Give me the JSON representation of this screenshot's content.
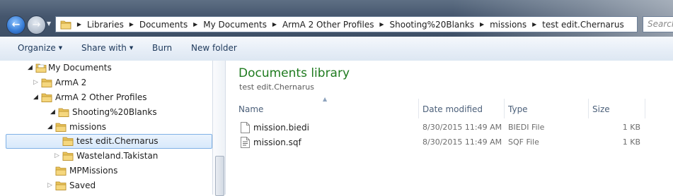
{
  "address_bar": {
    "breadcrumbs": [
      "Libraries",
      "Documents",
      "My Documents",
      "ArmA 2 Other Profiles",
      "Shooting%20Blanks",
      "missions",
      "test edit.Chernarus"
    ],
    "search_placeholder": "Search"
  },
  "command_bar": {
    "organize": "Organize",
    "share_with": "Share with",
    "burn": "Burn",
    "new_folder": "New folder"
  },
  "nav_tree": [
    {
      "label": "My Documents",
      "expander": "open"
    },
    {
      "label": "ArmA 2",
      "expander": "closed"
    },
    {
      "label": "ArmA 2 Other Profiles",
      "expander": "open"
    },
    {
      "label": "Shooting%20Blanks",
      "expander": "open"
    },
    {
      "label": "missions",
      "expander": "open"
    },
    {
      "label": "test edit.Chernarus",
      "expander": "none",
      "selected": true
    },
    {
      "label": "Wasteland.Takistan",
      "expander": "closed"
    },
    {
      "label": "MPMissions",
      "expander": "none"
    },
    {
      "label": "Saved",
      "expander": "closed"
    }
  ],
  "library": {
    "title": "Documents library",
    "subtitle": "test edit.Chernarus"
  },
  "columns": {
    "name": "Name",
    "date_modified": "Date modified",
    "type": "Type",
    "size": "Size"
  },
  "files": [
    {
      "name": "mission.biedi",
      "date": "8/30/2015 11:49 AM",
      "type": "BIEDI File",
      "size": "1 KB",
      "icon": "blank-file-icon"
    },
    {
      "name": "mission.sqf",
      "date": "8/30/2015 11:49 AM",
      "type": "SQF File",
      "size": "1 KB",
      "icon": "script-file-icon"
    }
  ]
}
